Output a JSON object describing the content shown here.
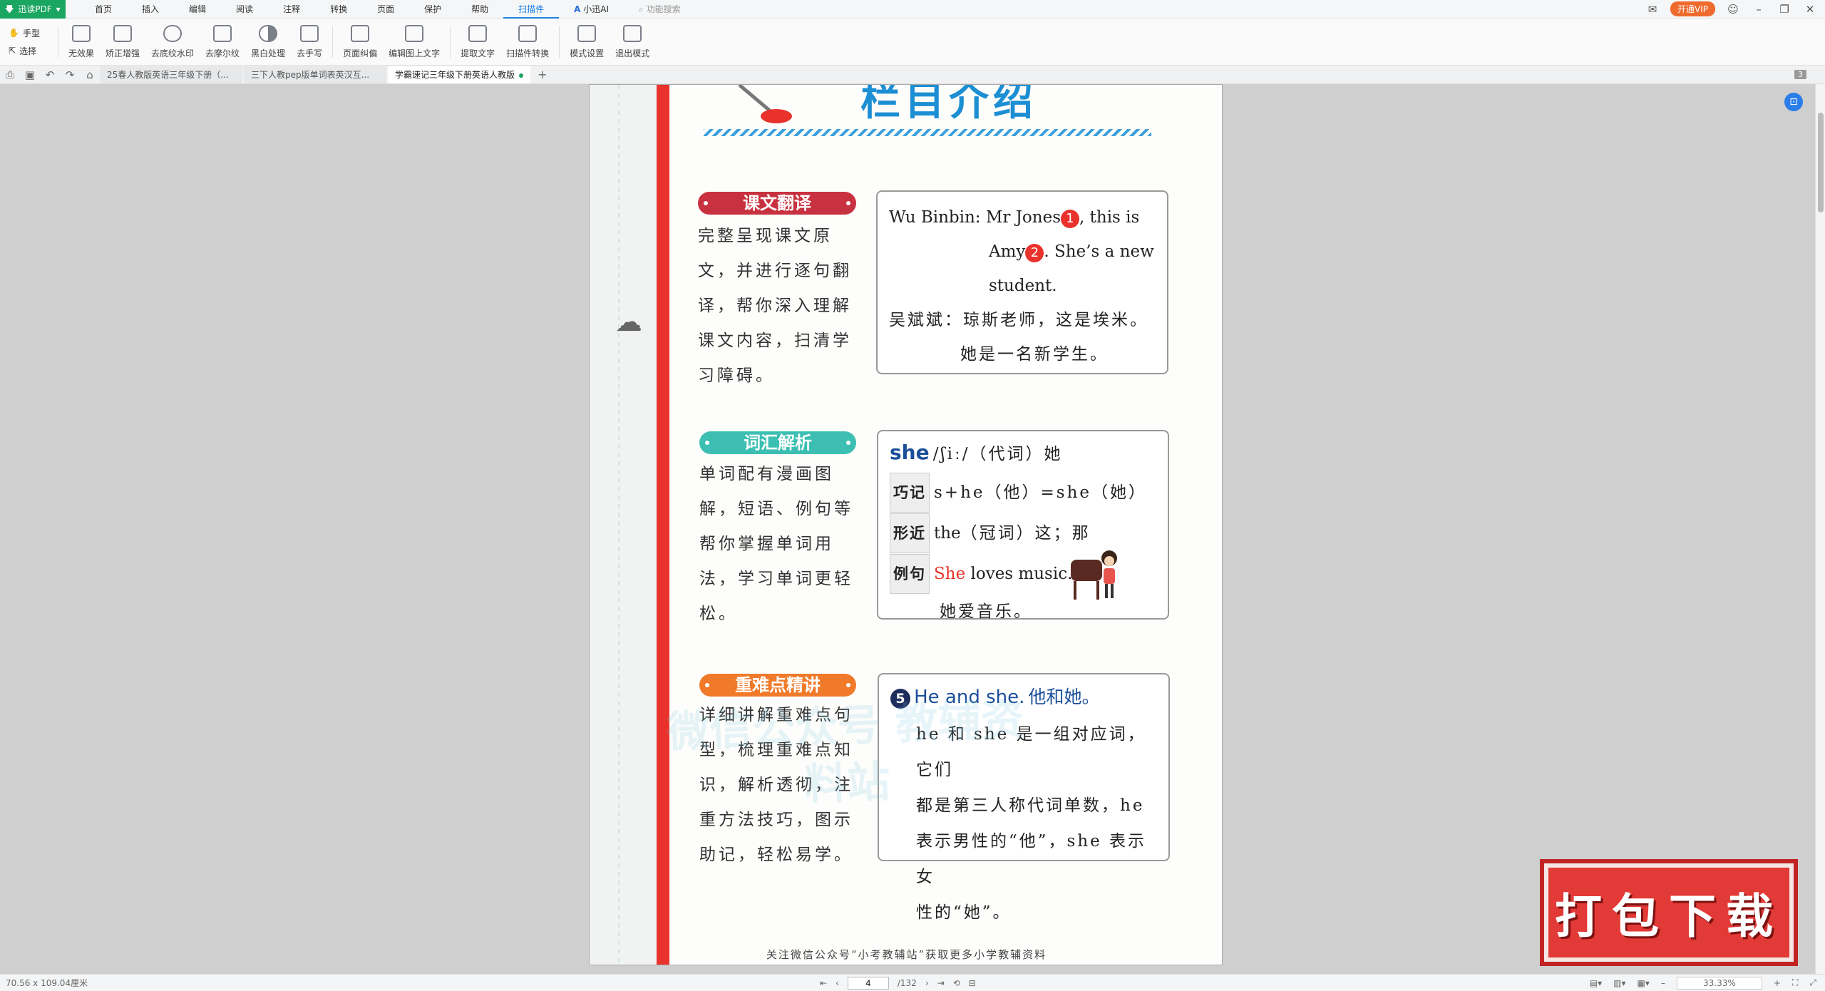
{
  "app": {
    "name": "迅读PDF"
  },
  "menu": [
    {
      "label": "首页"
    },
    {
      "label": "插入"
    },
    {
      "label": "编辑"
    },
    {
      "label": "阅读"
    },
    {
      "label": "注释"
    },
    {
      "label": "转换"
    },
    {
      "label": "页面"
    },
    {
      "label": "保护"
    },
    {
      "label": "帮助"
    },
    {
      "label": "扫描件"
    },
    {
      "label": "小迅AI"
    },
    {
      "label": "功能搜索"
    }
  ],
  "vip": {
    "label": "开通VIP"
  },
  "mode_tools": {
    "hand": "手型",
    "select": "选择"
  },
  "ribbon": [
    {
      "label": "无效果"
    },
    {
      "label": "矫正增强"
    },
    {
      "label": "去底纹水印"
    },
    {
      "label": "去摩尔纹"
    },
    {
      "label": "黑白处理"
    },
    {
      "label": "去手写"
    },
    {
      "label": "页面纠偏"
    },
    {
      "label": "编辑图上文字"
    },
    {
      "label": "提取文字"
    },
    {
      "label": "扫描件转换"
    },
    {
      "label": "模式设置"
    },
    {
      "label": "退出模式"
    }
  ],
  "tabs": [
    {
      "label": "25春人教版英语三年级下册（..."
    },
    {
      "label": "三下人教pep版单词表英汉互..."
    },
    {
      "label": "学霸速记三年级下册英语人教版"
    }
  ],
  "tab_count": "3",
  "page": {
    "heading": "栏目介绍",
    "sections": [
      {
        "badge": "课文翻译",
        "desc": "完整呈现课文原文，并进行逐句翻译，帮你深入理解课文内容，扫清学习障碍。"
      },
      {
        "badge": "词汇解析",
        "desc": "单词配有漫画图解，短语、例句等帮你掌握单词用法，学习单词更轻松。"
      },
      {
        "badge": "重难点精讲",
        "desc": "详细讲解重难点句型，梳理重难点知识，解析透彻，注重方法技巧，图示助记，轻松易学。"
      }
    ],
    "box1": {
      "speaker": "Wu Binbin:",
      "line1a": "Mr Jones",
      "n1": "1",
      "line1b": ", this is",
      "line2a": "Amy",
      "n2": "2",
      "line2b": ". She’s a new",
      "line3": "student.",
      "zh1": "吴斌斌：琼斯老师，这是埃米。",
      "zh2": "她是一名新学生。"
    },
    "box2": {
      "word": "she",
      "phon": "/ʃiː/（代词）她",
      "tag1": "巧记",
      "tip1": "s+he（他）=she（她）",
      "tag2": "形近",
      "tip2a": "the",
      "tip2b": "（冠词）这；那",
      "tag3": "例句",
      "ex_red": "She",
      "ex_rest": " loves music.",
      "ex_zh": "她爱音乐。"
    },
    "box3": {
      "num": "5",
      "title_en": "He and she.",
      "title_zh": "他和她。",
      "l1": "he 和 she 是一组对应词，它们",
      "l2": "都是第三人称代词单数，he",
      "l3": "表示男性的“他”，she 表示女",
      "l4": "性的“她”。"
    },
    "watermark": "微信公众号 教辅资料站",
    "footer": "关注微信公众号“小考教辅站”获取更多小学教辅资料"
  },
  "stamp": {
    "label": "打包下载"
  },
  "status": {
    "page_size": "70.56 x 109.04厘米",
    "current_page": "4",
    "total_pages": "/132",
    "zoom": "33.33%"
  },
  "colors": {
    "brand": "#1aa560",
    "accent": "#1a7fe0",
    "section_red": "#c8313f",
    "section_teal": "#3cbfb2",
    "section_orange": "#f07a2a"
  }
}
